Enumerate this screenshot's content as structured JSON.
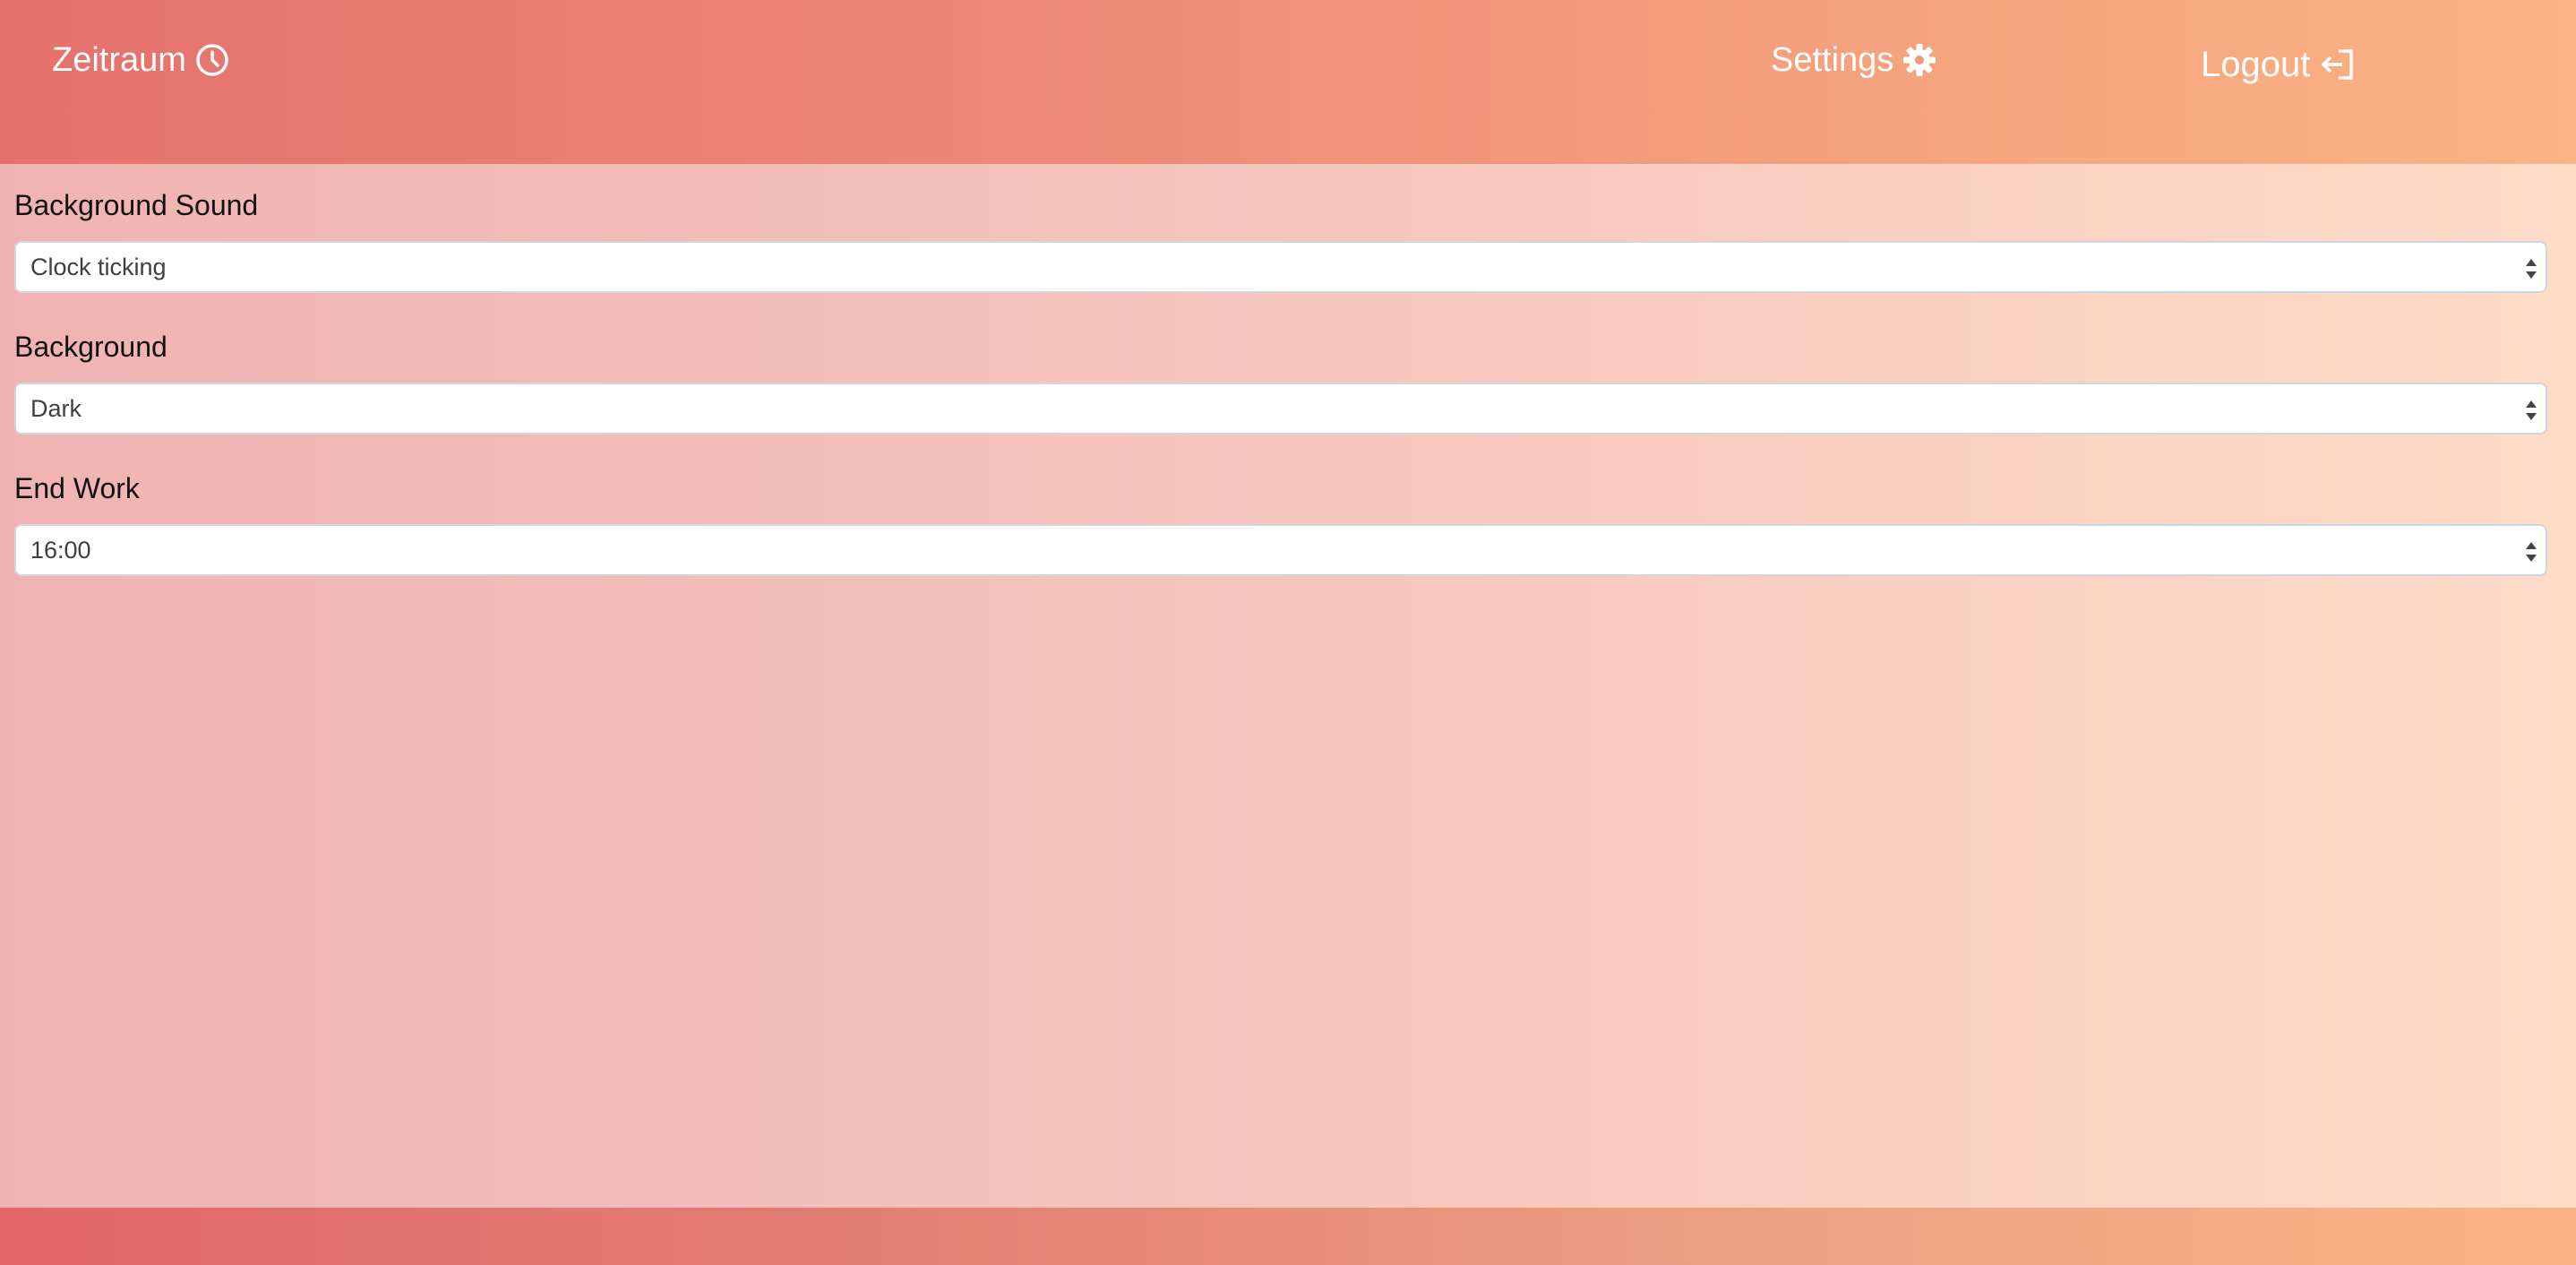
{
  "navbar": {
    "brand_label": "Zeitraum",
    "brand_icon": "clock-icon",
    "settings_label": "Settings",
    "settings_icon": "gear-icon",
    "logout_label": "Logout",
    "logout_icon": "sign-out-icon"
  },
  "settings": {
    "background_sound": {
      "label": "Background Sound",
      "selected": "Clock ticking"
    },
    "background": {
      "label": "Background",
      "selected": "Dark"
    },
    "end_work": {
      "label": "End Work",
      "selected": "16:00"
    }
  },
  "colors": {
    "navbar_start": "#e5716c",
    "navbar_end": "#fcb386",
    "page_start": "#f0b3b3",
    "page_end": "#fddcc8",
    "select_border": "#cfd6e0"
  }
}
